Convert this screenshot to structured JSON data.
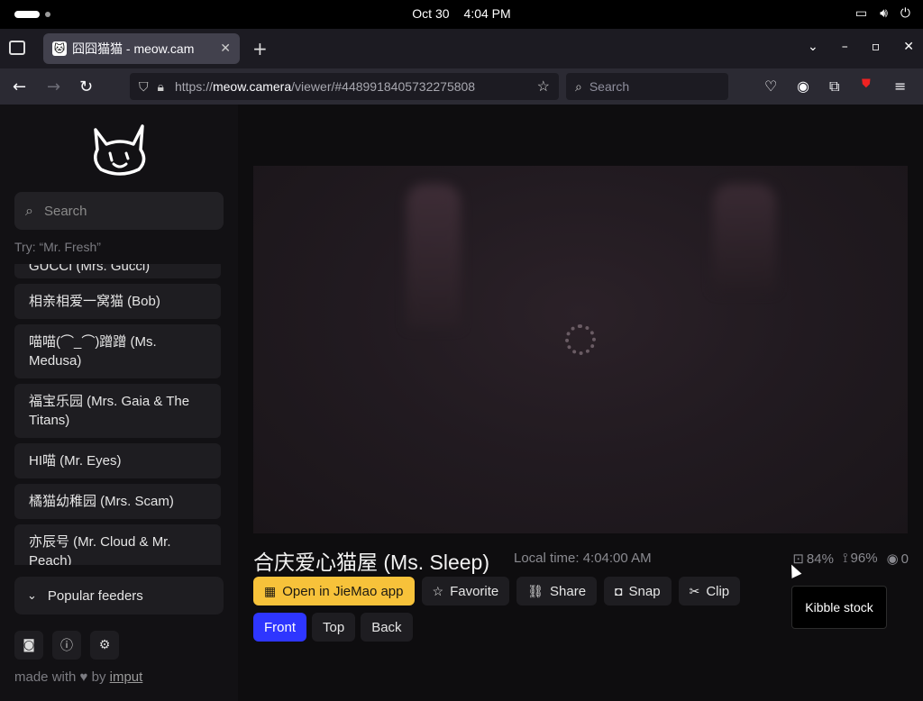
{
  "system": {
    "date": "Oct 30",
    "time": "4:04 PM",
    "icons": [
      "display-icon",
      "volume-icon",
      "power-icon"
    ]
  },
  "browser": {
    "tab_title": "囧囧猫猫 - meow.cam",
    "url_prefix": "https://",
    "url_host": "meow.camera",
    "url_path": "/viewer/#4489918405732275808",
    "search_placeholder": "Search"
  },
  "sidebar": {
    "search_placeholder": "Search",
    "try_hint": "Try: “Mr. Fresh”",
    "feeds": [
      "GUCCI (Mrs. Gucci)",
      "相亲相爱一窝猫 (Bob)",
      "喵喵(⌒_⌒)蹭蹭 (Ms. Medusa)",
      "福宝乐园 (Mrs. Gaia & The Titans)",
      "HI喵 (Mr. Eyes)",
      "橘猫幼稚园 (Mrs. Scam)",
      "亦辰号 (Mr. Cloud & Mr. Peach)"
    ],
    "popular_label": "Popular feeders",
    "made_with_prefix": "made with",
    "made_with_by": "by",
    "made_with_author": "imput"
  },
  "main": {
    "title": "合庆爱心猫屋 (Ms. Sleep)",
    "local_time": "Local time: 4:04:00 AM",
    "stats": {
      "kibble": "84%",
      "battery": "96%",
      "viewers": "0"
    },
    "actions": [
      "Open in JieMao app",
      "Favorite",
      "Share",
      "Snap",
      "Clip"
    ],
    "views": [
      "Front",
      "Top",
      "Back"
    ],
    "active_view": "Front",
    "tooltip": "Kibble stock"
  },
  "colors": {
    "primary_button": "#f7c23a",
    "active_view": "#2e36ff"
  }
}
